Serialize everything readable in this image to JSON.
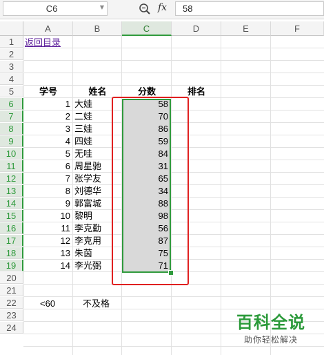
{
  "formula_bar": {
    "name_box": "C6",
    "fx_label": "fx",
    "value": "58"
  },
  "columns": [
    "A",
    "B",
    "C",
    "D",
    "E",
    "F"
  ],
  "selected_column": "C",
  "rows": [
    "1",
    "2",
    "3",
    "4",
    "5",
    "6",
    "7",
    "8",
    "9",
    "10",
    "11",
    "12",
    "13",
    "14",
    "15",
    "16",
    "17",
    "18",
    "19",
    "20",
    "21",
    "22",
    "23",
    "24"
  ],
  "cells": {
    "link": "返回目录",
    "headers": {
      "id": "学号",
      "name": "姓名",
      "score": "分数",
      "rank": "排名"
    },
    "records": [
      {
        "id": "1",
        "name": "大娃",
        "score": "58"
      },
      {
        "id": "2",
        "name": "二娃",
        "score": "70"
      },
      {
        "id": "3",
        "name": "三娃",
        "score": "86"
      },
      {
        "id": "4",
        "name": "四娃",
        "score": "59"
      },
      {
        "id": "5",
        "name": "无哇",
        "score": "84"
      },
      {
        "id": "6",
        "name": "周星驰",
        "score": "31"
      },
      {
        "id": "7",
        "name": "张学友",
        "score": "65"
      },
      {
        "id": "8",
        "name": "刘德华",
        "score": "34"
      },
      {
        "id": "9",
        "name": "郭富城",
        "score": "88"
      },
      {
        "id": "10",
        "name": "黎明",
        "score": "98"
      },
      {
        "id": "11",
        "name": "李克勤",
        "score": "56"
      },
      {
        "id": "12",
        "name": "李克用",
        "score": "87"
      },
      {
        "id": "13",
        "name": "朱茵",
        "score": "75"
      },
      {
        "id": "14",
        "name": "李光弼",
        "score": "71"
      }
    ],
    "criteria": {
      "label": "<60",
      "text": "不及格"
    }
  },
  "watermark": {
    "title": "百科全说",
    "subtitle": "助你轻松解决"
  },
  "colors": {
    "selection": "#2f9a3c",
    "highlight_box": "#e02020",
    "link": "#5b1e9a"
  }
}
